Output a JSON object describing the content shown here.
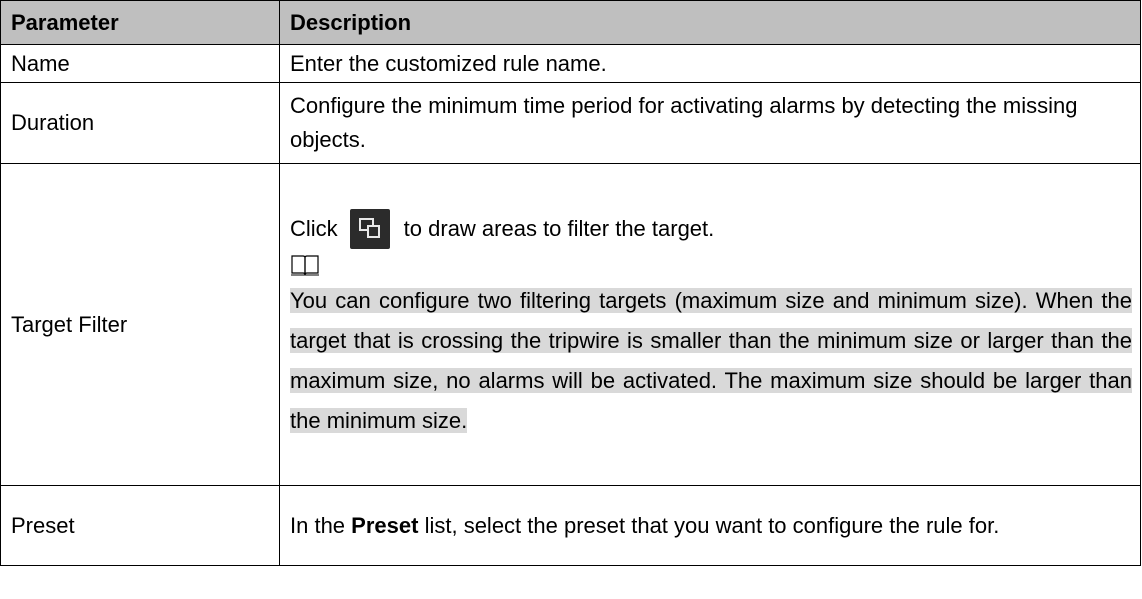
{
  "table": {
    "header": {
      "parameter": "Parameter",
      "description": "Description"
    },
    "rows": [
      {
        "parameter": "Name",
        "description": "Enter the customized rule name."
      },
      {
        "parameter": "Duration",
        "description": "Configure the minimum time period for activating alarms by detecting the missing objects."
      },
      {
        "parameter": "Target Filter",
        "click_prefix": "Click",
        "button_icon": "draw-area-icon",
        "click_suffix": "to draw areas to filter the target.",
        "note_icon": "book-note-icon",
        "note": "You can configure two filtering targets (maximum size and minimum size). When the target that is crossing the tripwire is smaller than the minimum size or larger than the maximum size, no alarms will be activated. The maximum size should be larger than the minimum size."
      },
      {
        "parameter": "Preset",
        "prefix": "In the",
        "bold": "Preset",
        "suffix": "list, select the preset that you want to configure the rule for."
      }
    ]
  },
  "colors": {
    "header_bg": "#bfbfbf",
    "note_highlight": "#d9d9d9",
    "button_bg": "#2b2b2b"
  }
}
